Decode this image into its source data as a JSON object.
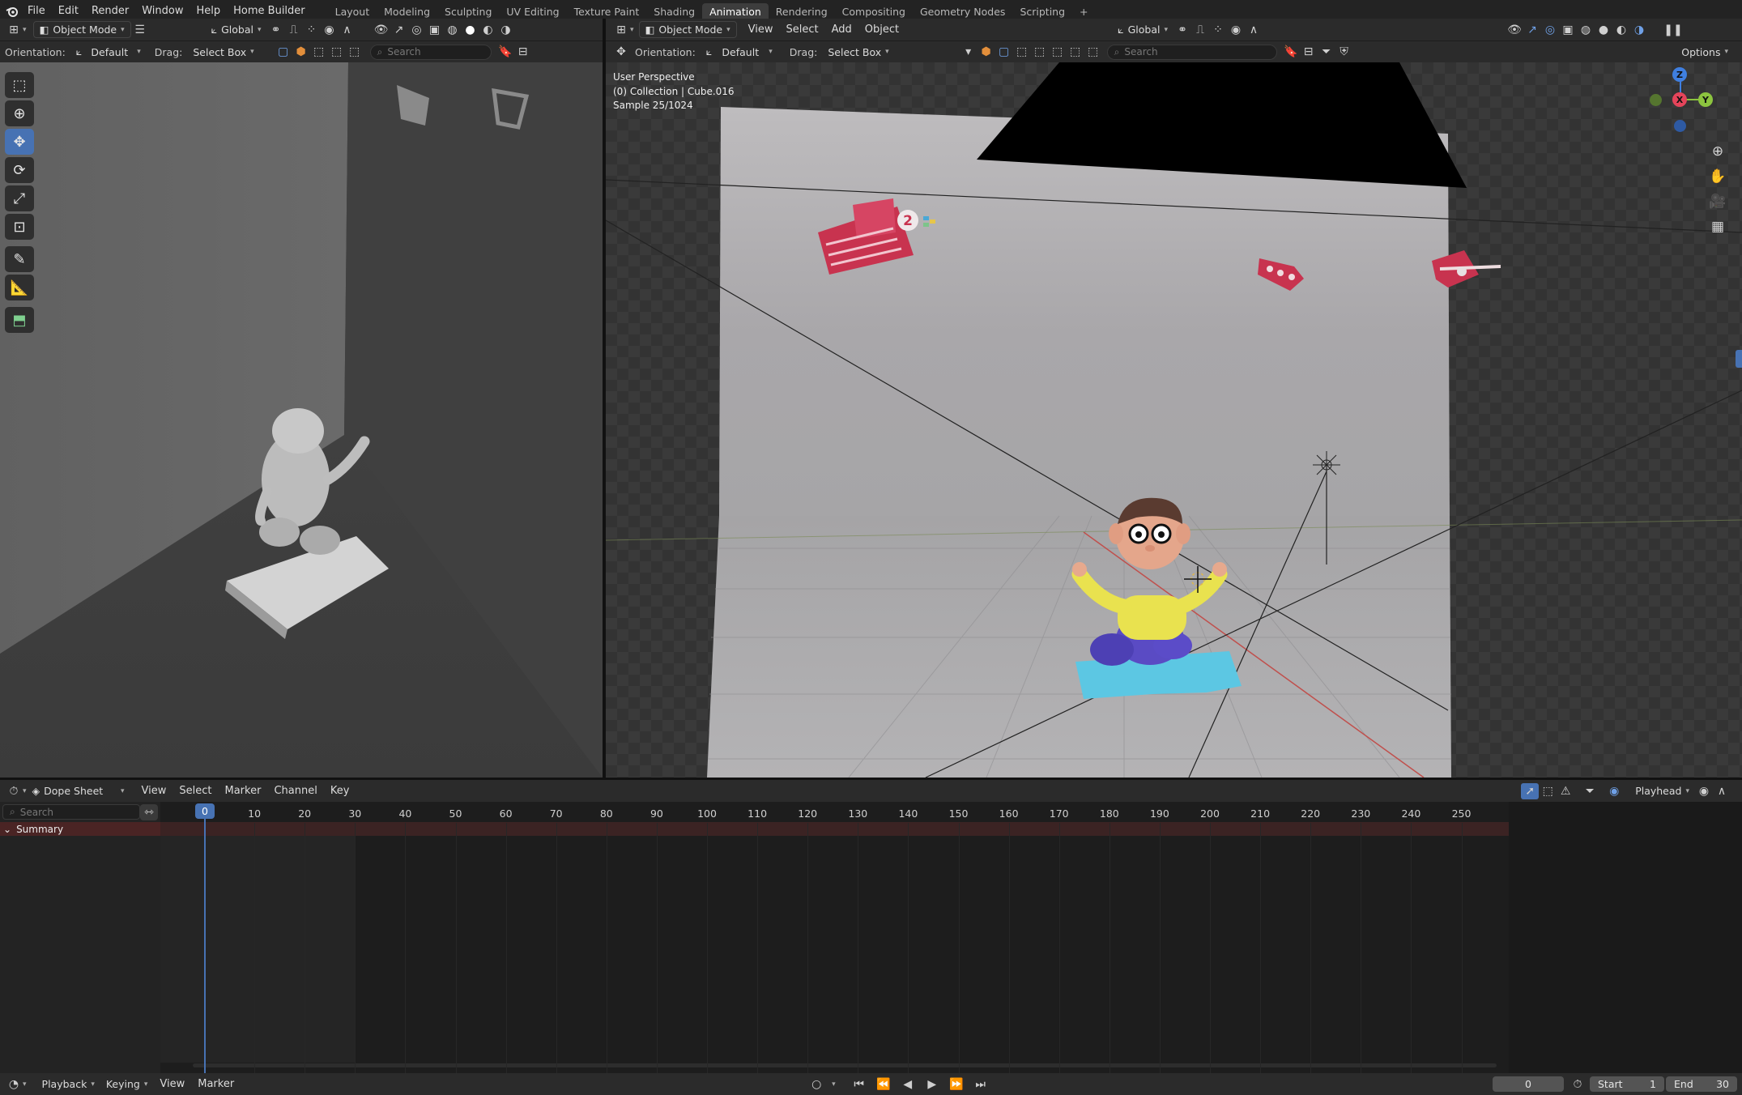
{
  "topbar": {
    "menus": [
      "File",
      "Edit",
      "Render",
      "Window",
      "Help",
      "Home Builder"
    ],
    "workspaces": [
      "Layout",
      "Modeling",
      "Sculpting",
      "UV Editing",
      "Texture Paint",
      "Shading",
      "Animation",
      "Rendering",
      "Compositing",
      "Geometry Nodes",
      "Scripting"
    ],
    "active_workspace": "Animation",
    "add_tab": "+"
  },
  "left_view": {
    "mode": "Object Mode",
    "transform": "Global",
    "orientation_label": "Orientation:",
    "orientation_value": "Default",
    "drag_label": "Drag:",
    "drag_value": "Select Box",
    "search_placeholder": "Search"
  },
  "right_view": {
    "mode": "Object Mode",
    "menus": [
      "View",
      "Select",
      "Add",
      "Object"
    ],
    "transform": "Global",
    "orientation_label": "Orientation:",
    "orientation_value": "Default",
    "drag_label": "Drag:",
    "drag_value": "Select Box",
    "search_placeholder": "Search",
    "options_label": "Options",
    "overlay_line1": "User Perspective",
    "overlay_line2": "(0) Collection | Cube.016",
    "overlay_line3": "Sample 25/1024",
    "gizmo": {
      "x": "X",
      "y": "Y",
      "z": "Z"
    },
    "card_number": "2"
  },
  "dopesheet": {
    "editor": "Dope Sheet",
    "menus": [
      "View",
      "Select",
      "Marker",
      "Channel",
      "Key"
    ],
    "search_placeholder": "Search",
    "playhead_label": "Playhead",
    "summary_label": "Summary",
    "current_frame_badge": "0",
    "ticks": [
      "10",
      "20",
      "30",
      "40",
      "50",
      "60",
      "70",
      "80",
      "90",
      "100",
      "110",
      "120",
      "130",
      "140",
      "150",
      "160",
      "170",
      "180",
      "190",
      "200",
      "210",
      "220",
      "230",
      "240",
      "250"
    ]
  },
  "timeline": {
    "menus": [
      "Playback",
      "Keying",
      "View",
      "Marker"
    ],
    "current_frame": "0",
    "start_label": "Start",
    "start_value": "1",
    "end_label": "End",
    "end_value": "30"
  },
  "colors": {
    "accent": "#4772b3",
    "active_ws": "#3d3d3d",
    "summary_bg": "#4a2424",
    "gizmo_x": "#e5445a",
    "gizmo_y": "#8cc43f",
    "gizmo_z": "#3f7fe0"
  }
}
